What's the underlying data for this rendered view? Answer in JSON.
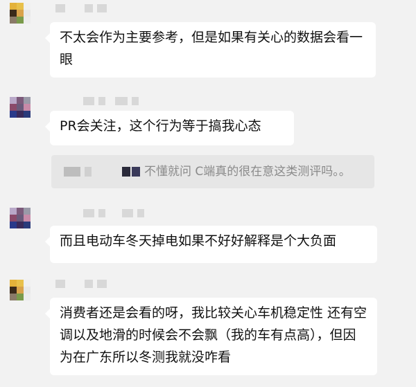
{
  "messages": [
    {
      "text": "不太会作为主要参考，但是如果有关心的数据会看一眼"
    },
    {
      "text": "PR会关注，这个行为等于搞我心态"
    },
    {
      "text": "而且电动车冬天掉电如果不好好解释是个大负面"
    },
    {
      "text": "消费者还是会看的呀，我比较关心车机稳定性 还有空调以及地滑的时候会不会飘（我的车有点高），但因为在广东所以冬测我就没咋看"
    }
  ],
  "quote": {
    "text": "不懂就问 C端真的很在意这类测评吗。。"
  },
  "colors": {
    "background": "#f2f2f2",
    "bubble": "#ffffff",
    "quote_bg": "#e6e6e6",
    "quote_text": "#8a8a8a"
  }
}
